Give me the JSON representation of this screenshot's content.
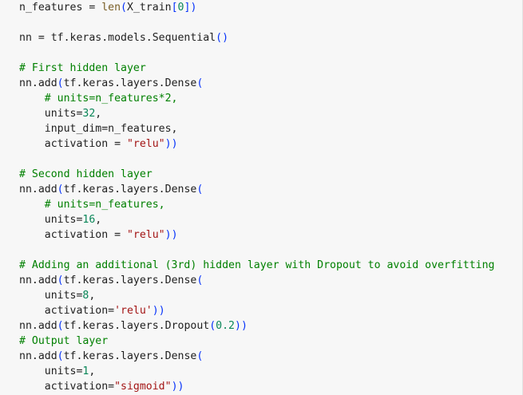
{
  "colors": {
    "background": "#f7f7f7",
    "default": "#1f1f1f",
    "comment": "#008000",
    "string": "#a31515",
    "number": "#098658",
    "builtin": "#795e26",
    "bracket": "#0431fa"
  },
  "code_lines": [
    {
      "name": "n-features-assignment",
      "tokens": [
        {
          "t": "default",
          "v": "n_features = "
        },
        {
          "t": "builtin",
          "v": "len"
        },
        {
          "t": "bracket",
          "v": "("
        },
        {
          "t": "default",
          "v": "X_train"
        },
        {
          "t": "bracket",
          "v": "["
        },
        {
          "t": "number",
          "v": "0"
        },
        {
          "t": "bracket",
          "v": "]"
        },
        {
          "t": "bracket",
          "v": ")"
        }
      ]
    },
    {
      "name": "blank",
      "tokens": []
    },
    {
      "name": "nn-sequential",
      "tokens": [
        {
          "t": "default",
          "v": "nn = tf.keras.models.Sequential"
        },
        {
          "t": "bracket",
          "v": "()"
        }
      ]
    },
    {
      "name": "blank",
      "tokens": []
    },
    {
      "name": "comment-first-hidden-layer",
      "tokens": [
        {
          "t": "comment",
          "v": "# First hidden layer"
        }
      ]
    },
    {
      "name": "nn-add-dense-1",
      "tokens": [
        {
          "t": "default",
          "v": "nn.add"
        },
        {
          "t": "bracket",
          "v": "("
        },
        {
          "t": "default",
          "v": "tf.keras.layers.Dense"
        },
        {
          "t": "bracket",
          "v": "("
        }
      ]
    },
    {
      "name": "comment-units-n-features-2",
      "tokens": [
        {
          "t": "default",
          "v": "    "
        },
        {
          "t": "comment",
          "v": "# units=n_features*2,"
        }
      ]
    },
    {
      "name": "units-32",
      "tokens": [
        {
          "t": "default",
          "v": "    units="
        },
        {
          "t": "number",
          "v": "32"
        },
        {
          "t": "default",
          "v": ","
        }
      ]
    },
    {
      "name": "input-dim",
      "tokens": [
        {
          "t": "default",
          "v": "    input_dim=n_features,"
        }
      ]
    },
    {
      "name": "activation-relu-1",
      "tokens": [
        {
          "t": "default",
          "v": "    activation = "
        },
        {
          "t": "string",
          "v": "\"relu\""
        },
        {
          "t": "bracket",
          "v": ")"
        },
        {
          "t": "bracket",
          "v": ")"
        }
      ]
    },
    {
      "name": "blank",
      "tokens": []
    },
    {
      "name": "comment-second-hidden-layer",
      "tokens": [
        {
          "t": "comment",
          "v": "# Second hidden layer"
        }
      ]
    },
    {
      "name": "nn-add-dense-2",
      "tokens": [
        {
          "t": "default",
          "v": "nn.add"
        },
        {
          "t": "bracket",
          "v": "("
        },
        {
          "t": "default",
          "v": "tf.keras.layers.Dense"
        },
        {
          "t": "bracket",
          "v": "("
        }
      ]
    },
    {
      "name": "comment-units-n-features",
      "tokens": [
        {
          "t": "default",
          "v": "    "
        },
        {
          "t": "comment",
          "v": "# units=n_features,"
        }
      ]
    },
    {
      "name": "units-16",
      "tokens": [
        {
          "t": "default",
          "v": "    units="
        },
        {
          "t": "number",
          "v": "16"
        },
        {
          "t": "default",
          "v": ","
        }
      ]
    },
    {
      "name": "activation-relu-2",
      "tokens": [
        {
          "t": "default",
          "v": "    activation = "
        },
        {
          "t": "string",
          "v": "\"relu\""
        },
        {
          "t": "bracket",
          "v": ")"
        },
        {
          "t": "bracket",
          "v": ")"
        }
      ]
    },
    {
      "name": "blank",
      "tokens": []
    },
    {
      "name": "comment-third-hidden-layer",
      "tokens": [
        {
          "t": "comment",
          "v": "# Adding an additional (3rd) hidden layer with Dropout to avoid overfitting"
        }
      ]
    },
    {
      "name": "nn-add-dense-3",
      "tokens": [
        {
          "t": "default",
          "v": "nn.add"
        },
        {
          "t": "bracket",
          "v": "("
        },
        {
          "t": "default",
          "v": "tf.keras.layers.Dense"
        },
        {
          "t": "bracket",
          "v": "("
        }
      ]
    },
    {
      "name": "units-8",
      "tokens": [
        {
          "t": "default",
          "v": "    units="
        },
        {
          "t": "number",
          "v": "8"
        },
        {
          "t": "default",
          "v": ","
        }
      ]
    },
    {
      "name": "activation-relu-3",
      "tokens": [
        {
          "t": "default",
          "v": "    activation="
        },
        {
          "t": "string",
          "v": "'relu'"
        },
        {
          "t": "bracket",
          "v": ")"
        },
        {
          "t": "bracket",
          "v": ")"
        }
      ]
    },
    {
      "name": "nn-add-dropout",
      "tokens": [
        {
          "t": "default",
          "v": "nn.add"
        },
        {
          "t": "bracket",
          "v": "("
        },
        {
          "t": "default",
          "v": "tf.keras.layers.Dropout"
        },
        {
          "t": "bracket",
          "v": "("
        },
        {
          "t": "number",
          "v": "0.2"
        },
        {
          "t": "bracket",
          "v": ")"
        },
        {
          "t": "bracket",
          "v": ")"
        }
      ]
    },
    {
      "name": "comment-output-layer",
      "tokens": [
        {
          "t": "comment",
          "v": "# Output layer"
        }
      ]
    },
    {
      "name": "nn-add-dense-output",
      "tokens": [
        {
          "t": "default",
          "v": "nn.add"
        },
        {
          "t": "bracket",
          "v": "("
        },
        {
          "t": "default",
          "v": "tf.keras.layers.Dense"
        },
        {
          "t": "bracket",
          "v": "("
        }
      ]
    },
    {
      "name": "units-1",
      "tokens": [
        {
          "t": "default",
          "v": "    units="
        },
        {
          "t": "number",
          "v": "1"
        },
        {
          "t": "default",
          "v": ","
        }
      ]
    },
    {
      "name": "activation-sigmoid",
      "tokens": [
        {
          "t": "default",
          "v": "    activation="
        },
        {
          "t": "string",
          "v": "\"sigmoid\""
        },
        {
          "t": "bracket",
          "v": ")"
        },
        {
          "t": "bracket",
          "v": ")"
        }
      ]
    }
  ]
}
